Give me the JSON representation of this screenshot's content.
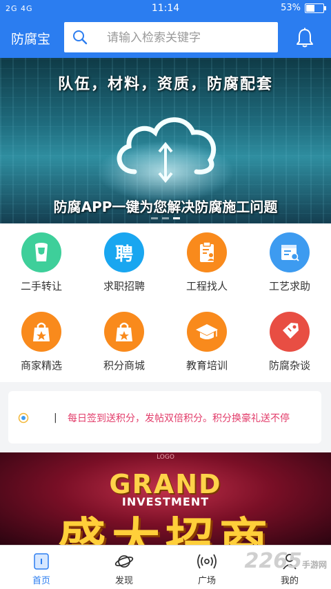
{
  "status_bar": {
    "signal": "2G 4G",
    "time": "11:14",
    "battery": "53%",
    "battery_level": 0.53
  },
  "header": {
    "title": "防腐宝",
    "search_placeholder": "请输入检索关键字"
  },
  "banner": {
    "headline": "队伍，材料，资质，防腐配套",
    "tagline": "防腐APP一键为您解决防腐施工问题",
    "slide_count": 3,
    "active_slide": 2
  },
  "menu": [
    {
      "label": "二手转让",
      "icon": "paint-bucket-icon",
      "color": "#3ecf9a"
    },
    {
      "label": "求职招聘",
      "icon": "recruit-icon",
      "color": "#19a6f0",
      "glyph": "聘"
    },
    {
      "label": "工程找人",
      "icon": "clipboard-person-icon",
      "color": "#f98a1c"
    },
    {
      "label": "工艺求助",
      "icon": "document-search-icon",
      "color": "#3d9bf0"
    },
    {
      "label": "商家精选",
      "icon": "shopping-bag-star-icon",
      "color": "#f98a1c"
    },
    {
      "label": "积分商城",
      "icon": "shopping-bag-star-icon",
      "color": "#f98a1c"
    },
    {
      "label": "教育培训",
      "icon": "graduation-cap-icon",
      "color": "#f98a1c"
    },
    {
      "label": "防腐杂谈",
      "icon": "price-tag-icon",
      "color": "#e84e43"
    }
  ],
  "notice": {
    "separator": "|",
    "text": "每日签到送积分，发帖双倍积分。积分换豪礼送不停"
  },
  "promo": {
    "logo": "LOGO",
    "title_en": "GRAND",
    "subtitle_en": "INVESTMENT",
    "title_cn": "盛大招商"
  },
  "tabs": [
    {
      "label": "首页",
      "icon": "home-icon",
      "active": true
    },
    {
      "label": "发现",
      "icon": "planet-icon",
      "active": false
    },
    {
      "label": "广场",
      "icon": "broadcast-icon",
      "active": false
    },
    {
      "label": "我的",
      "icon": "user-icon",
      "active": false
    }
  ],
  "watermark": {
    "number": "2265",
    "site": "手游网"
  },
  "colors": {
    "primary": "#2b7df0",
    "notice_text": "#e23c6a"
  }
}
